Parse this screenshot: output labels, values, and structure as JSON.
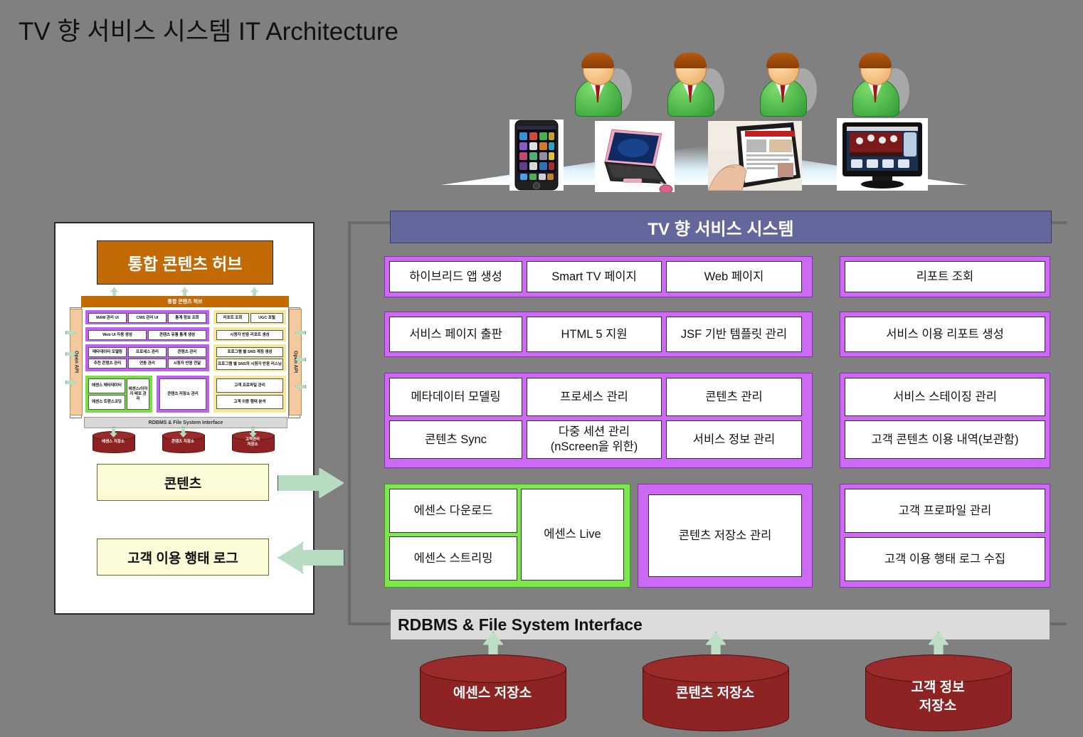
{
  "title": "TV 향 서비스 시스템 IT Architecture",
  "colors": {
    "background": "#808080",
    "hub_orange": "#C26A06",
    "system_header": "#63679B",
    "purple": "#CE69F5",
    "green": "#7DE84B",
    "yellow": "#FCFBD8",
    "cylinder_red": "#8E2323",
    "arrow_green": "#B7DCC0",
    "rdbms_gray": "#DCDCDC"
  },
  "audience": {
    "people_count": 4,
    "devices": [
      "smartphone-image",
      "laptop-image",
      "tablet-image",
      "smart-tv-image"
    ]
  },
  "left_panel": {
    "hub_title": "통합 콘텐츠 허브",
    "mini": {
      "bar_label": "통합 콘텐츠 허브",
      "open_api_left": "Open API",
      "open_api_right": "Open API",
      "groups": [
        {
          "color": "purple",
          "cells": [
            "MAM 관리 UI",
            "CMS 관리 UI",
            "통계 정보 조회"
          ]
        },
        {
          "color": "purple",
          "cells": [
            "Web UI 자동 생성",
            "콘텐츠 유통 통계 생성"
          ]
        },
        {
          "color": "purple",
          "cells": [
            "메타데이터 모델링",
            "프로세스 관리",
            "콘텐츠 관리",
            "추천 콘텐츠 관리",
            "연동 관리",
            "시청자 반응 전달"
          ]
        },
        {
          "color": "yellow",
          "cells": [
            "리포트 조회",
            "UGC 포털"
          ]
        },
        {
          "color": "yellow",
          "cells": [
            "시청자 반응 리포트 생성"
          ]
        },
        {
          "color": "yellow",
          "cells": [
            "프로그램 별 SNS 계정 생성",
            "프로그램 별 SNS의 시청자 반응 리스닝"
          ]
        },
        {
          "color": "green",
          "cells": [
            "에센스 메타데이터",
            "에센스 트랜스코딩",
            "에센스/이미지 배포 관리"
          ]
        },
        {
          "color": "purple",
          "cells": [
            "콘텐츠 저장소 관리"
          ]
        },
        {
          "color": "yellow",
          "cells": [
            "고객 프로파일 관리",
            "고객 이용 행태 분석"
          ]
        }
      ],
      "rdbms_label": "RDBMS & File System Interface",
      "cylinders": [
        "에센스 저장소",
        "콘텐츠 저장소",
        "고객관리 저장소"
      ]
    },
    "content_box": "콘텐츠",
    "log_box": "고객 이용 행태 로그",
    "arrow_to_system": "arrow-right-icon",
    "arrow_from_system": "arrow-left-icon"
  },
  "system": {
    "header": "TV 향 서비스 시스템",
    "groups": {
      "g1": {
        "color": "purple",
        "cells": [
          "하이브리드 앱 생성",
          "Smart TV 페이지",
          "Web 페이지"
        ]
      },
      "g2": {
        "color": "purple",
        "cells": [
          "리포트 조회"
        ]
      },
      "g3": {
        "color": "purple",
        "cells": [
          "서비스 페이지 출판",
          "HTML 5 지원",
          "JSF 기반 템플릿 관리"
        ]
      },
      "g4": {
        "color": "purple",
        "cells": [
          "서비스 이용 리포트 생성"
        ]
      },
      "g5": {
        "color": "purple",
        "cells": [
          "메타데이터 모델링",
          "프로세스 관리",
          "콘텐츠 관리",
          "콘텐츠 Sync",
          "다중 세션 관리\n(nScreen을 위한)",
          "서비스 정보 관리"
        ]
      },
      "g6": {
        "color": "purple",
        "cells": [
          "서비스 스테이징 관리",
          "고객 콘텐츠 이용 내역(보관함)"
        ]
      },
      "g7": {
        "color": "green",
        "cells_left": [
          "에센스 다운로드",
          "에센스 스트리밍"
        ],
        "cells_right": [
          "에센스 Live"
        ]
      },
      "g8": {
        "color": "purple",
        "cells": [
          "콘텐츠 저장소 관리"
        ]
      },
      "g9": {
        "color": "purple",
        "cells": [
          "고객 프로파일 관리",
          "고객 이용 행태 로그 수집"
        ]
      }
    },
    "rdbms_bar": "RDBMS & File System Interface",
    "cylinders": [
      "에센스 저장소",
      "콘텐츠 저장소",
      "고객 정보\n저장소"
    ]
  }
}
